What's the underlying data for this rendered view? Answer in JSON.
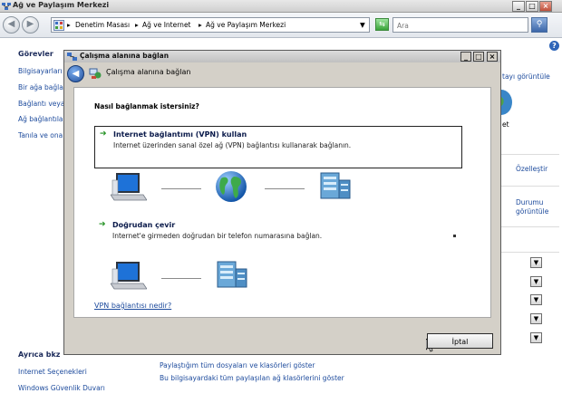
{
  "window": {
    "title": "Ağ ve Paylaşım Merkezi",
    "buttons": {
      "minimize": "_",
      "maximize": "□",
      "close": "×"
    }
  },
  "address_bar": {
    "breadcrumbs": [
      "Denetim Masası",
      "Ağ ve Internet",
      "Ağ ve Paylaşım Merkezi"
    ],
    "search_placeholder": "Ara"
  },
  "left_pane": {
    "heading": "Görevler",
    "links": [
      "Bilgisayarları",
      "Bir ağa bağla",
      "Bağlantı veya",
      "Ağ bağlantıla",
      "Tanıla ve ona"
    ],
    "see_also_heading": "Ayrıca bkz",
    "see_also_links": [
      "Internet Seçenekleri",
      "Windows Güvenlik Duvarı"
    ]
  },
  "right_pane": {
    "view_map_link": "tayı görüntüle",
    "partial_label": "et",
    "customize_link": "Özelleştir",
    "status_link_line1": "Durumu",
    "status_link_line2": "görüntüle"
  },
  "bottom_links": [
    "Paylaştığım tüm dosyaları ve klasörleri göster",
    "Bu bilgisayardaki tüm paylaşılan ağ klasörlerini göster"
  ],
  "dialog": {
    "title": "Çalışma alanına bağlan",
    "header_text": "Çalışma alanına bağlan",
    "question": "Nasıl bağlanmak istersiniz?",
    "options": [
      {
        "title": "Internet bağlantımı (VPN) kullan",
        "description": "Internet üzerinden sanal özel ağ (VPN) bağlantısı kullanarak bağlanın."
      },
      {
        "title": "Doğrudan çevir",
        "description": "Internet'e girmeden doğrudan bir telefon numarasına bağlan."
      }
    ],
    "help_link": "VPN bağlantısı nedir?",
    "cancel_label": "İptal"
  },
  "colors": {
    "link": "#1c4a9c",
    "arrow": "#1e8f1e",
    "dialog_bg": "#d4d0c8"
  }
}
